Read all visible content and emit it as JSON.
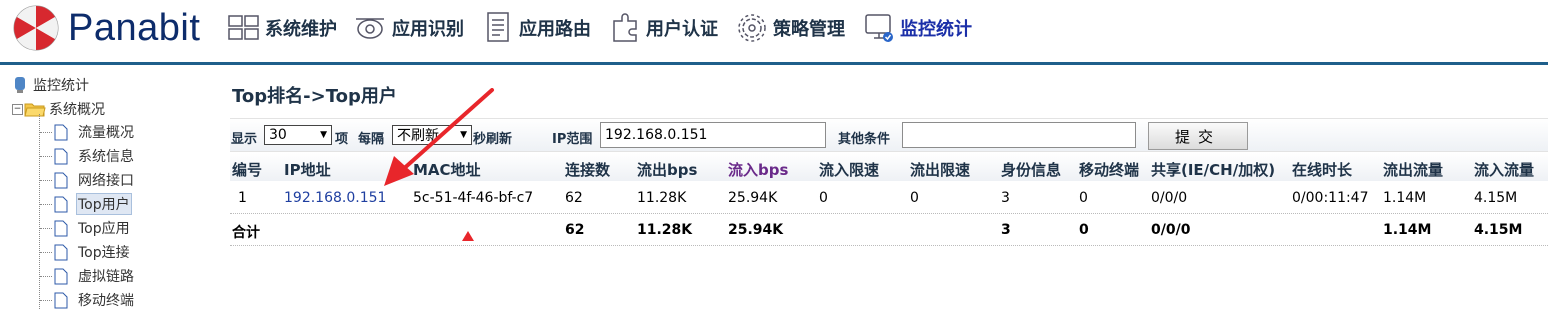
{
  "header": {
    "logo_text": "Panabit",
    "nav": [
      {
        "label": "系统维护",
        "icon": "system-maintenance-icon",
        "active": false
      },
      {
        "label": "应用识别",
        "icon": "app-identify-icon",
        "active": false
      },
      {
        "label": "应用路由",
        "icon": "app-route-icon",
        "active": false
      },
      {
        "label": "用户认证",
        "icon": "user-auth-icon",
        "active": false
      },
      {
        "label": "策略管理",
        "icon": "policy-gear-icon",
        "active": false
      },
      {
        "label": "监控统计",
        "icon": "monitor-stats-icon",
        "active": true
      }
    ],
    "accent_color": "#1f5f8b"
  },
  "sidebar": {
    "root_label": "监控统计",
    "folder_label": "系统概况",
    "items": [
      {
        "label": "流量概况",
        "selected": false
      },
      {
        "label": "系统信息",
        "selected": false
      },
      {
        "label": "网络接口",
        "selected": false
      },
      {
        "label": "Top用户",
        "selected": true
      },
      {
        "label": "Top应用",
        "selected": false
      },
      {
        "label": "Top连接",
        "selected": false
      },
      {
        "label": "虚拟链路",
        "selected": false
      },
      {
        "label": "移动终端",
        "selected": false
      }
    ]
  },
  "main": {
    "title": "Top排名->Top用户",
    "filters": {
      "show_label": "显示",
      "show_value": "30",
      "item_label": "项",
      "interval_label": "每隔",
      "interval_value": "不刷新",
      "refresh_label": "秒刷新",
      "ip_range_label": "IP范围",
      "ip_range_value": "192.168.0.151",
      "other_label": "其他条件",
      "other_value": "",
      "submit_label": "提交"
    },
    "table": {
      "columns": [
        "编号",
        "IP地址",
        "MAC地址",
        "连接数",
        "流出bps",
        "流入bps",
        "流入限速",
        "流出限速",
        "身份信息",
        "移动终端",
        "共享(IE/CH/加权)",
        "在线时长",
        "流出流量",
        "流入流量"
      ],
      "rows": [
        [
          "1",
          "192.168.0.151",
          "5c-51-4f-46-bf-c7",
          "62",
          "11.28K",
          "25.94K",
          "0",
          "0",
          "3",
          "0",
          "0/0/0",
          "0/00:11:47",
          "1.14M",
          "4.15M"
        ]
      ],
      "total": {
        "label": "合计",
        "connections": "62",
        "out_bps": "11.28K",
        "in_bps": "25.94K",
        "identity": "3",
        "mobile": "0",
        "shared": "0/0/0",
        "out_traffic": "1.14M",
        "in_traffic": "4.15M"
      }
    }
  },
  "colors": {
    "link": "#1f3fa0",
    "heading": "#1f3348",
    "purple_header": "#6a2a8a",
    "annotation": "#e8262b"
  }
}
